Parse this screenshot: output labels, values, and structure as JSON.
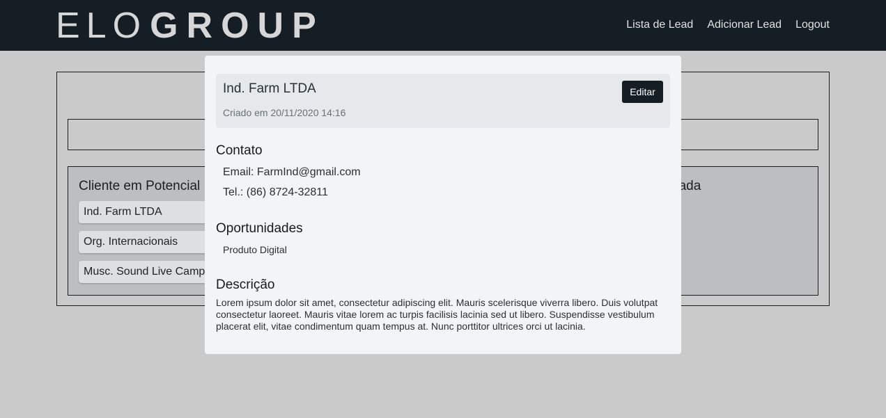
{
  "header": {
    "logo_light": "ELO",
    "logo_bold": "GROUP",
    "nav": [
      "Lista de Lead",
      "Adicionar Lead",
      "Logout"
    ]
  },
  "board": {
    "column_left_title": "Cliente em Potencial",
    "column_right_title_partial": "dada",
    "leads": [
      "Ind. Farm LTDA",
      "Org. Internacionais",
      "Musc. Sound Live Camp"
    ]
  },
  "modal": {
    "lead_name": "Ind. Farm LTDA",
    "created": "Criado em 20/11/2020 14:16",
    "edit_label": "Editar",
    "contact_title": "Contato",
    "email": "Email: FarmInd@gmail.com",
    "phone": "Tel.: (86) 8724-32811",
    "opportunities_title": "Oportunidades",
    "opportunities": [
      "Produto Digital"
    ],
    "description_title": "Descrição",
    "description": "Lorem ipsum dolor sit amet, consectetur adipiscing elit. Mauris scelerisque viverra libero. Duis volutpat consectetur laoreet. Mauris vitae lorem ac turpis facilisis lacinia sed ut libero. Suspendisse vestibulum placerat elit, vitae condimentum quam tempus at. Nunc porttitor ultrices orci ut lacinia."
  },
  "colors": {
    "navbar": "#141e24",
    "page_bg": "#cacaca",
    "modal_bg": "#f3f4f6",
    "button_bg": "#141e24"
  }
}
